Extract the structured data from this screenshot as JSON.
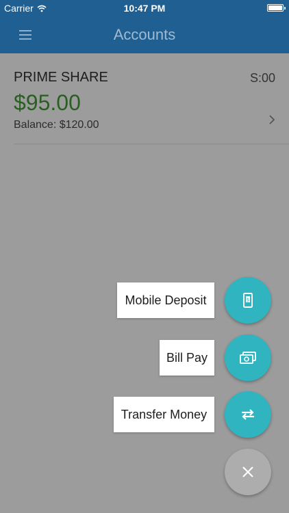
{
  "status_bar": {
    "carrier": "Carrier",
    "time": "10:47 PM"
  },
  "nav": {
    "title": "Accounts"
  },
  "account": {
    "name": "PRIME SHARE",
    "code": "S:00",
    "available": "$95.00",
    "balance": "Balance: $120.00"
  },
  "actions": [
    {
      "label": "Mobile Deposit",
      "icon": "mobile-deposit-icon"
    },
    {
      "label": "Bill Pay",
      "icon": "cash-icon"
    },
    {
      "label": "Transfer Money",
      "icon": "transfer-arrows-icon"
    }
  ],
  "close_icon": "close-icon",
  "colors": {
    "header": "#1f5f92",
    "fab": "#2fb4c0",
    "amount": "#2a5f22",
    "overlay": "#9c9c9c"
  }
}
